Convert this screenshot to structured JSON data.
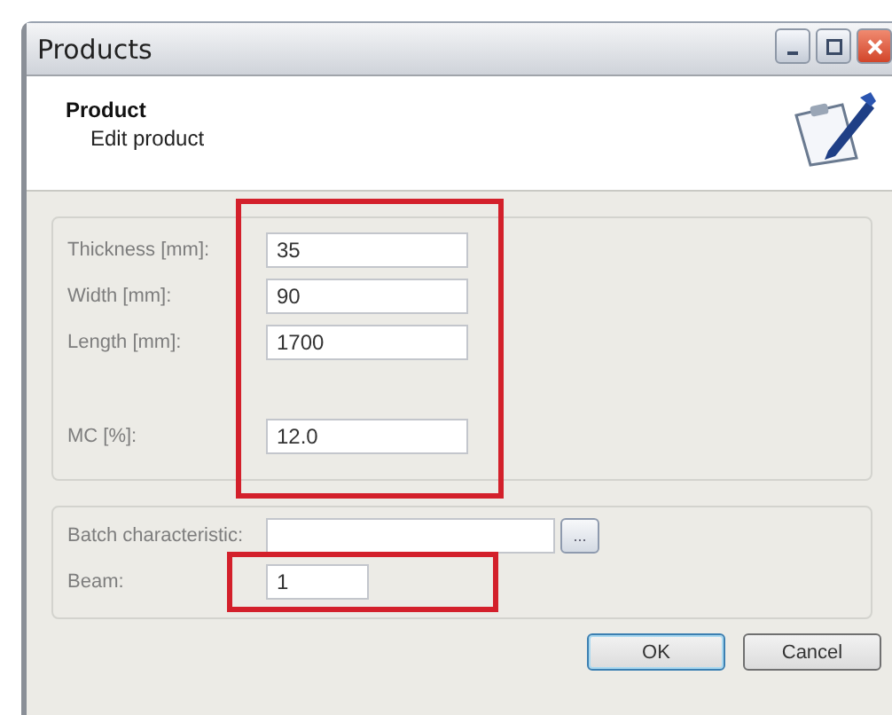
{
  "window": {
    "title": "Products"
  },
  "header": {
    "title": "Product",
    "subtitle": "Edit product"
  },
  "groups": [
    {
      "highlighted": true,
      "fields": [
        {
          "label": "Thickness [mm]:",
          "value": "35"
        },
        {
          "label": "Width [mm]:",
          "value": "90"
        },
        {
          "label": "Length [mm]:",
          "value": "1700"
        },
        {
          "label": "MC [%]:",
          "value": "12.0",
          "separated": true
        }
      ]
    },
    {
      "fields": [
        {
          "label": "Batch characteristic:",
          "browse": "..."
        },
        {
          "label": "Beam:",
          "value": "1",
          "highlighted": true
        }
      ]
    }
  ],
  "buttons": [
    "OK",
    "Cancel"
  ]
}
